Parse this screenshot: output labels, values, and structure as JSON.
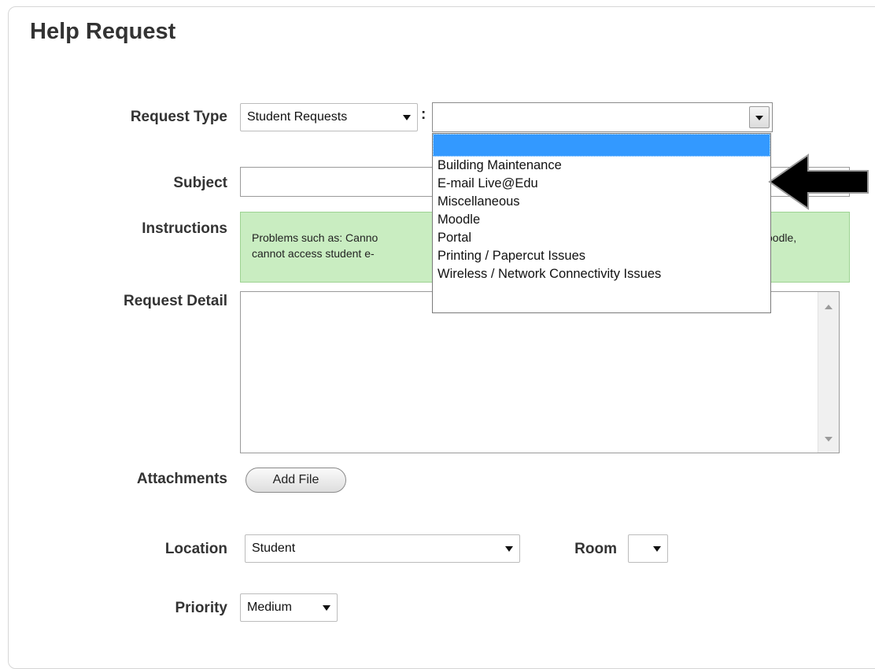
{
  "page_title": "Help Request",
  "fields": {
    "request_type_label": "Request Type",
    "request_type_value": "Student Requests",
    "request_type_separator": ":",
    "subject_label": "Subject",
    "instructions_label": "Instructions",
    "instructions_text_left": "Problems such as: Canno",
    "instructions_text_left2": "cannot access student e-",
    "instructions_text_right": "oodle,",
    "request_detail_label": "Request Detail",
    "attachments_label": "Attachments",
    "add_file_button": "Add File",
    "location_label": "Location",
    "location_value": "Student",
    "room_label": "Room",
    "priority_label": "Priority",
    "priority_value": "Medium"
  },
  "category_dropdown": {
    "options": [
      "",
      "Building Maintenance",
      "E-mail Live@Edu",
      "Miscellaneous",
      "Moodle",
      "Portal",
      "Printing / Papercut Issues",
      "Wireless / Network Connectivity Issues"
    ],
    "highlighted_index": 0,
    "highlight_color": "#3399ff"
  },
  "colors": {
    "instructions_bg": "#c9edc1",
    "instructions_border": "#9dd392",
    "pointer_arrow": "#000000"
  }
}
